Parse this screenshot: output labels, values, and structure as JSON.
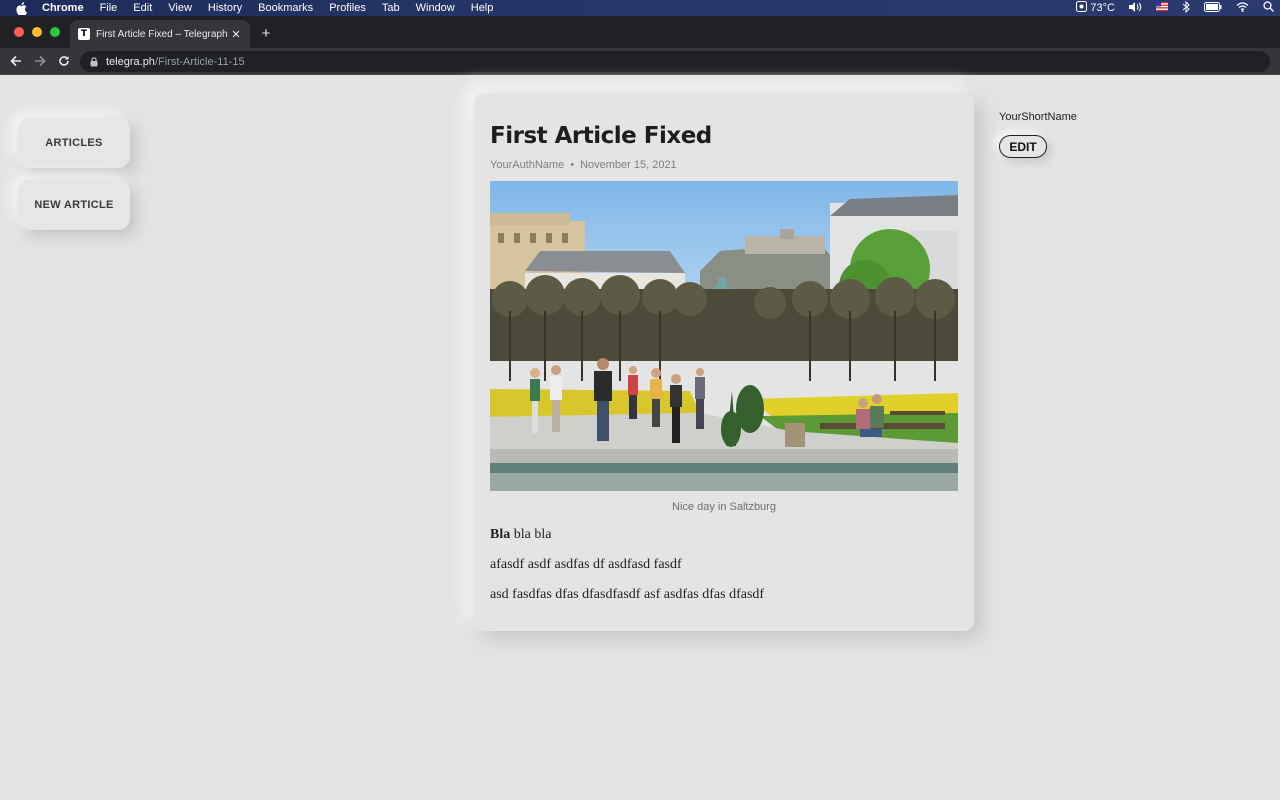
{
  "menubar": {
    "app": "Chrome",
    "items": [
      "File",
      "Edit",
      "View",
      "History",
      "Bookmarks",
      "Profiles",
      "Tab",
      "Window",
      "Help"
    ],
    "status": {
      "weather": "73°C"
    }
  },
  "browser": {
    "tab_title": "First Article Fixed – Telegraph",
    "favicon_letter": "T",
    "url_host": "telegra.ph",
    "url_path": "/First-Article-11-15"
  },
  "sidebar": {
    "articles_label": "ARTICLES",
    "new_article_label": "NEW ARTICLE"
  },
  "article": {
    "title": "First Article Fixed",
    "author": "YourAuthName",
    "separator": "•",
    "date": "November 15, 2021",
    "caption": "Nice day in Saltzburg",
    "p1_bold": "Bla",
    "p1_rest": " bla bla",
    "p2": "afasdf asdf asdfas df asdfasd fasdf",
    "p3": "asd fasdfas dfas dfasdfasdf asf asdfas dfas dfasdf"
  },
  "account": {
    "short_name": "YourShortName",
    "edit_label": "EDIT"
  },
  "colors": {
    "page_bg": "#e3e3e3",
    "close_dot": "#ff5f57",
    "min_dot": "#febc2e",
    "max_dot": "#28c840"
  }
}
